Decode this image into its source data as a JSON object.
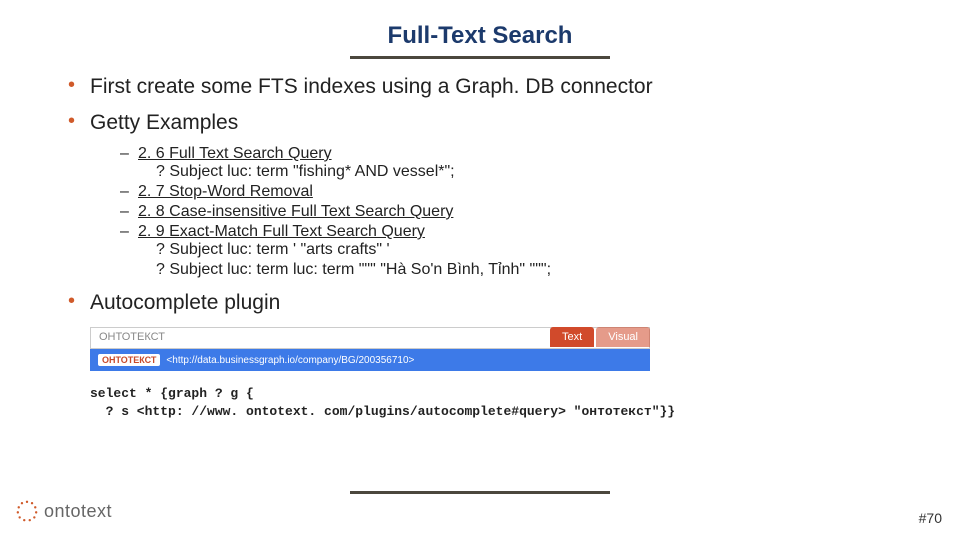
{
  "title": "Full-Text Search",
  "bullets": {
    "b1": "First create some FTS indexes using a Graph. DB connector",
    "b2": "Getty Examples",
    "b3": "Autocomplete plugin"
  },
  "sub": {
    "s1_link": "2. 6 Full Text Search Query",
    "s1_detail": "? Subject luc: term \"fishing* AND vessel*\";",
    "s2_link": "2. 7 Stop-Word Removal",
    "s3_link": "2. 8 Case-insensitive Full Text Search Query",
    "s4_link": "2. 9 Exact-Match Full Text Search Query",
    "s4_detail1": "? Subject luc: term ' \"arts crafts\" '",
    "s4_detail2": "? Subject luc: term luc: term \"\"\" \"Hà So'n Bình, Tỉnh\" \"\"\";"
  },
  "ac": {
    "input": "ОНТОТЕКСТ",
    "chip": "ОНТОТЕКСТ",
    "suggest": "<http://data.businessgraph.io/company/BG/200356710>",
    "tab_text": "Text",
    "tab_visual": "Visual"
  },
  "code": "select * {graph ? g {\n  ? s <http: //www. ontotext. com/plugins/autocomplete#query> \"онтотекст\"}}",
  "logo": "ontotext",
  "page": "#70"
}
